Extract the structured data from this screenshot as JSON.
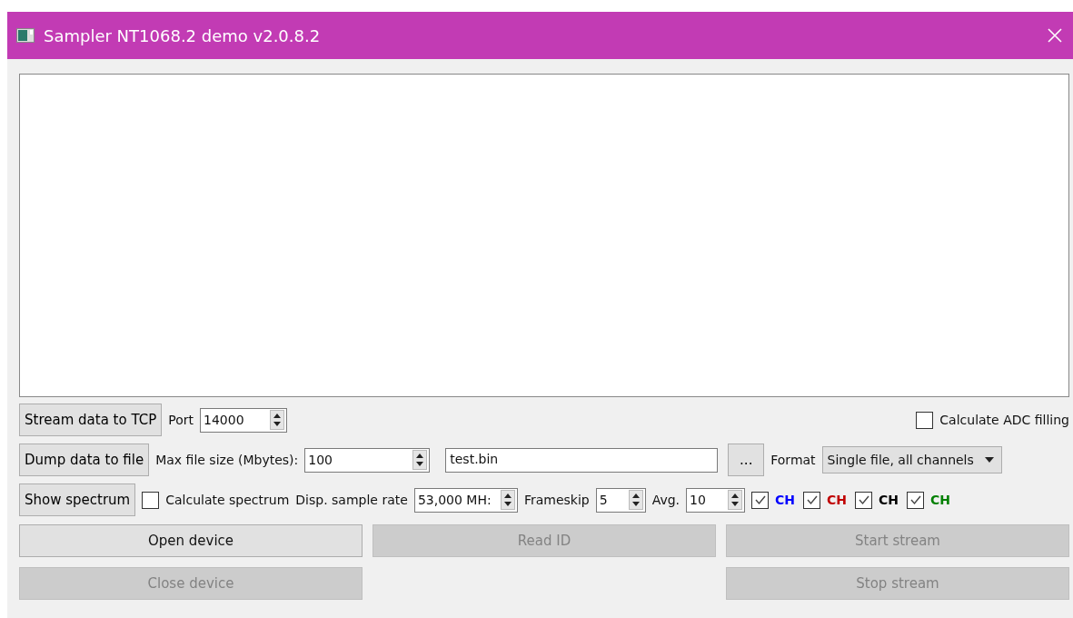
{
  "window": {
    "title": "Sampler NT1068.2 demo v2.0.8.2"
  },
  "stream_row": {
    "button": "Stream data to TCP",
    "port_label": "Port",
    "port_value": "14000",
    "adc_filling": {
      "label": "Calculate ADC filling",
      "checked": false
    }
  },
  "dump_row": {
    "button": "Dump data to file",
    "max_size_label": "Max file size (Mbytes):",
    "max_size_value": "100",
    "file_name": "test.bin",
    "browse_button": "...",
    "format_label": "Format",
    "format_value": "Single file, all channels"
  },
  "spectrum_row": {
    "button": "Show spectrum",
    "calc_spectrum": {
      "label": "Calculate spectrum",
      "checked": false
    },
    "rate_label": "Disp. sample rate",
    "rate_value": "53,000 MH:",
    "frameskip_label": "Frameskip",
    "frameskip_value": "5",
    "avg_label": "Avg.",
    "avg_value": "10",
    "channels": [
      {
        "label": "CH",
        "checked": true,
        "color": "#0000ff"
      },
      {
        "label": "CH",
        "checked": true,
        "color": "#c00000"
      },
      {
        "label": "CH",
        "checked": true,
        "color": "#000000"
      },
      {
        "label": "CH",
        "checked": true,
        "color": "#008000"
      }
    ]
  },
  "action_buttons": [
    {
      "label": "Open device",
      "disabled": false
    },
    {
      "label": "Read ID",
      "disabled": true
    },
    {
      "label": "Start stream",
      "disabled": true
    },
    {
      "label": "Close device",
      "disabled": true
    },
    {
      "label": "Stop stream",
      "disabled": true
    }
  ]
}
